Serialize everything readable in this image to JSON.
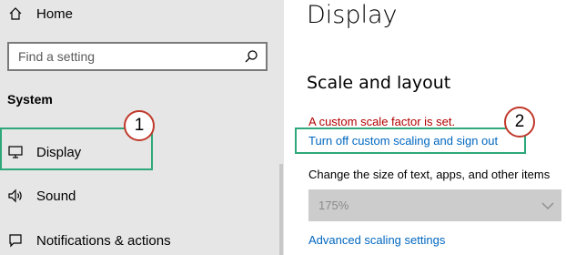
{
  "sidebar": {
    "home_label": "Home",
    "search_placeholder": "Find a setting",
    "section_label": "System",
    "items": [
      {
        "label": "Display"
      },
      {
        "label": "Sound"
      },
      {
        "label": "Notifications & actions"
      }
    ]
  },
  "main": {
    "title": "Display",
    "section_title": "Scale and layout",
    "warning": "A custom scale factor is set.",
    "turn_off_link": "Turn off custom scaling and sign out",
    "size_label": "Change the size of text, apps, and other items",
    "scale_value": "175%",
    "advanced_link": "Advanced scaling settings"
  },
  "annotations": {
    "badge_1": "1",
    "badge_2": "2",
    "highlight_color": "#2ea87a",
    "badge_border_color": "#c0392b"
  },
  "icons": {
    "home": "home-icon",
    "search": "search-icon",
    "display": "monitor-icon",
    "sound": "speaker-icon",
    "notifications": "notification-icon",
    "dropdown": "chevron-down-icon"
  }
}
